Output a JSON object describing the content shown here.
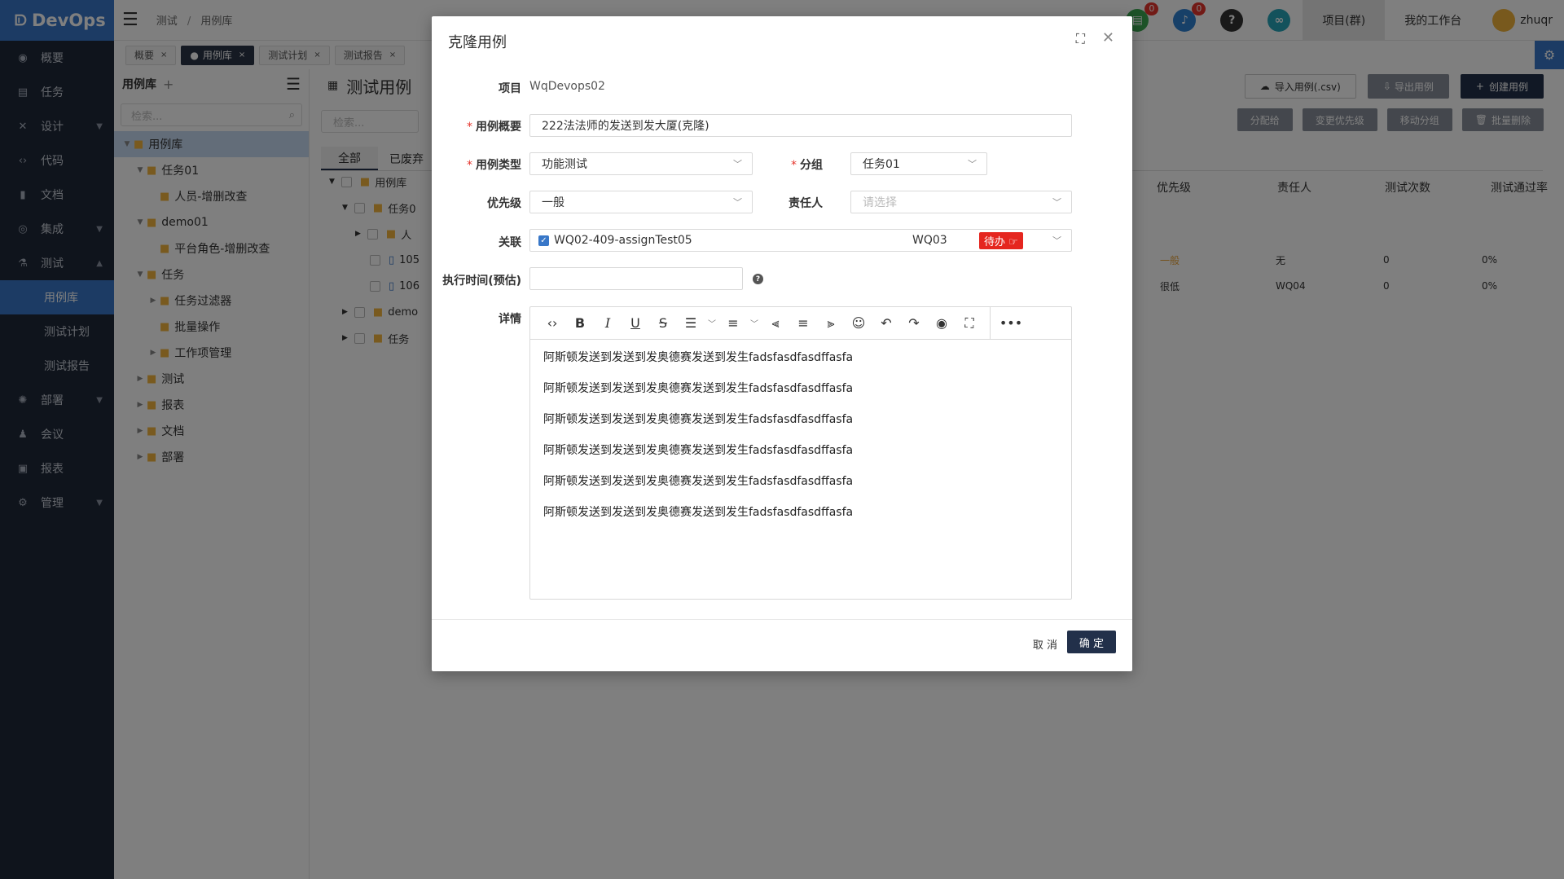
{
  "app": {
    "logo": "DevOps"
  },
  "sidebar": {
    "items": [
      {
        "label": "概要",
        "icon": "dashboard-icon"
      },
      {
        "label": "任务",
        "icon": "task-icon"
      },
      {
        "label": "设计",
        "icon": "design-icon"
      },
      {
        "label": "代码",
        "icon": "code-icon"
      },
      {
        "label": "文档",
        "icon": "document-icon"
      },
      {
        "label": "集成",
        "icon": "integration-icon"
      },
      {
        "label": "测试",
        "icon": "flask-icon"
      }
    ],
    "sub": [
      "用例库",
      "测试计划",
      "测试报告"
    ],
    "items2": [
      {
        "label": "部署",
        "icon": "deploy-icon"
      },
      {
        "label": "会议",
        "icon": "meeting-icon"
      },
      {
        "label": "报表",
        "icon": "report-icon"
      },
      {
        "label": "管理",
        "icon": "gear-icon"
      }
    ]
  },
  "topbar": {
    "crumb1": "测试",
    "crumb_sep": "/",
    "crumb2": "用例库",
    "badge1": "0",
    "badge2": "0",
    "project_btn": "项目(群)",
    "workbench_btn": "我的工作台",
    "user": "zhuqr"
  },
  "pagetabs": [
    "概要",
    "用例库",
    "测试计划",
    "测试报告"
  ],
  "tree": {
    "title": "用例库",
    "search_ph": "检索...",
    "nodes": [
      "用例库",
      "任务01",
      "人员-增删改查",
      "demo01",
      "平台角色-增删改查",
      "任务",
      "任务过滤器",
      "批量操作",
      "工作项管理",
      "测试",
      "报表",
      "文档",
      "部署"
    ]
  },
  "content": {
    "title": "测试用例",
    "search_ph": "检索...",
    "btn_import": "导入用例(.csv)",
    "btn_export": "导出用例",
    "btn_create": "创建用例",
    "btn_assign": "分配给",
    "btn_priority": "变更优先级",
    "btn_move": "移动分组",
    "btn_delete": "批量删除",
    "tab_all": "全部",
    "tab_discarded": "已废弃",
    "col_priority": "优先级",
    "col_owner": "责任人",
    "col_count": "测试次数",
    "col_rate": "测试通过率",
    "rows": [
      {
        "name": "用例库"
      },
      {
        "name": "任务0"
      },
      {
        "name": "人"
      },
      {
        "id": "105",
        "priority": "一般",
        "owner": "无",
        "count": "0",
        "rate": "0%"
      },
      {
        "id": "106",
        "priority": "很低",
        "owner": "WQ04",
        "count": "0",
        "rate": "0%"
      },
      {
        "name": "demo"
      },
      {
        "name": "任务"
      }
    ]
  },
  "modal": {
    "title": "克隆用例",
    "project_label": "项目",
    "project_value": "WqDevops02",
    "summary_label": "用例概要",
    "summary_value": "222法法师的发送到发大厦(克隆)",
    "type_label": "用例类型",
    "type_value": "功能测试",
    "group_label": "分组",
    "group_value": "任务01",
    "priority_label": "优先级",
    "priority_value": "一般",
    "owner_label": "责任人",
    "owner_placeholder": "请选择",
    "relate_label": "关联",
    "relate_value": "WQ02-409-assignTest05",
    "relate_user": "WQ03",
    "relate_status": "待办",
    "exec_label": "执行时间(预估)",
    "detail_label": "详情",
    "detail_lines": [
      "阿斯顿发送到发送到发奥德赛发送到发生fadsfasdfasdffasfa",
      "阿斯顿发送到发送到发奥德赛发送到发生fadsfasdfasdffasfa",
      "阿斯顿发送到发送到发奥德赛发送到发生fadsfasdfasdffasfa",
      "阿斯顿发送到发送到发奥德赛发送到发生fadsfasdfasdffasfa",
      "阿斯顿发送到发送到发奥德赛发送到发生fadsfasdfasdffasfa",
      "阿斯顿发送到发送到发奥德赛发送到发生fadsfasdfasdffasfa"
    ],
    "cancel": "取 消",
    "ok": "确 定"
  },
  "colors": {
    "accent": "#3877c8",
    "dark": "#22304a",
    "sidebar": "#1f2838",
    "danger": "#e5261f"
  }
}
